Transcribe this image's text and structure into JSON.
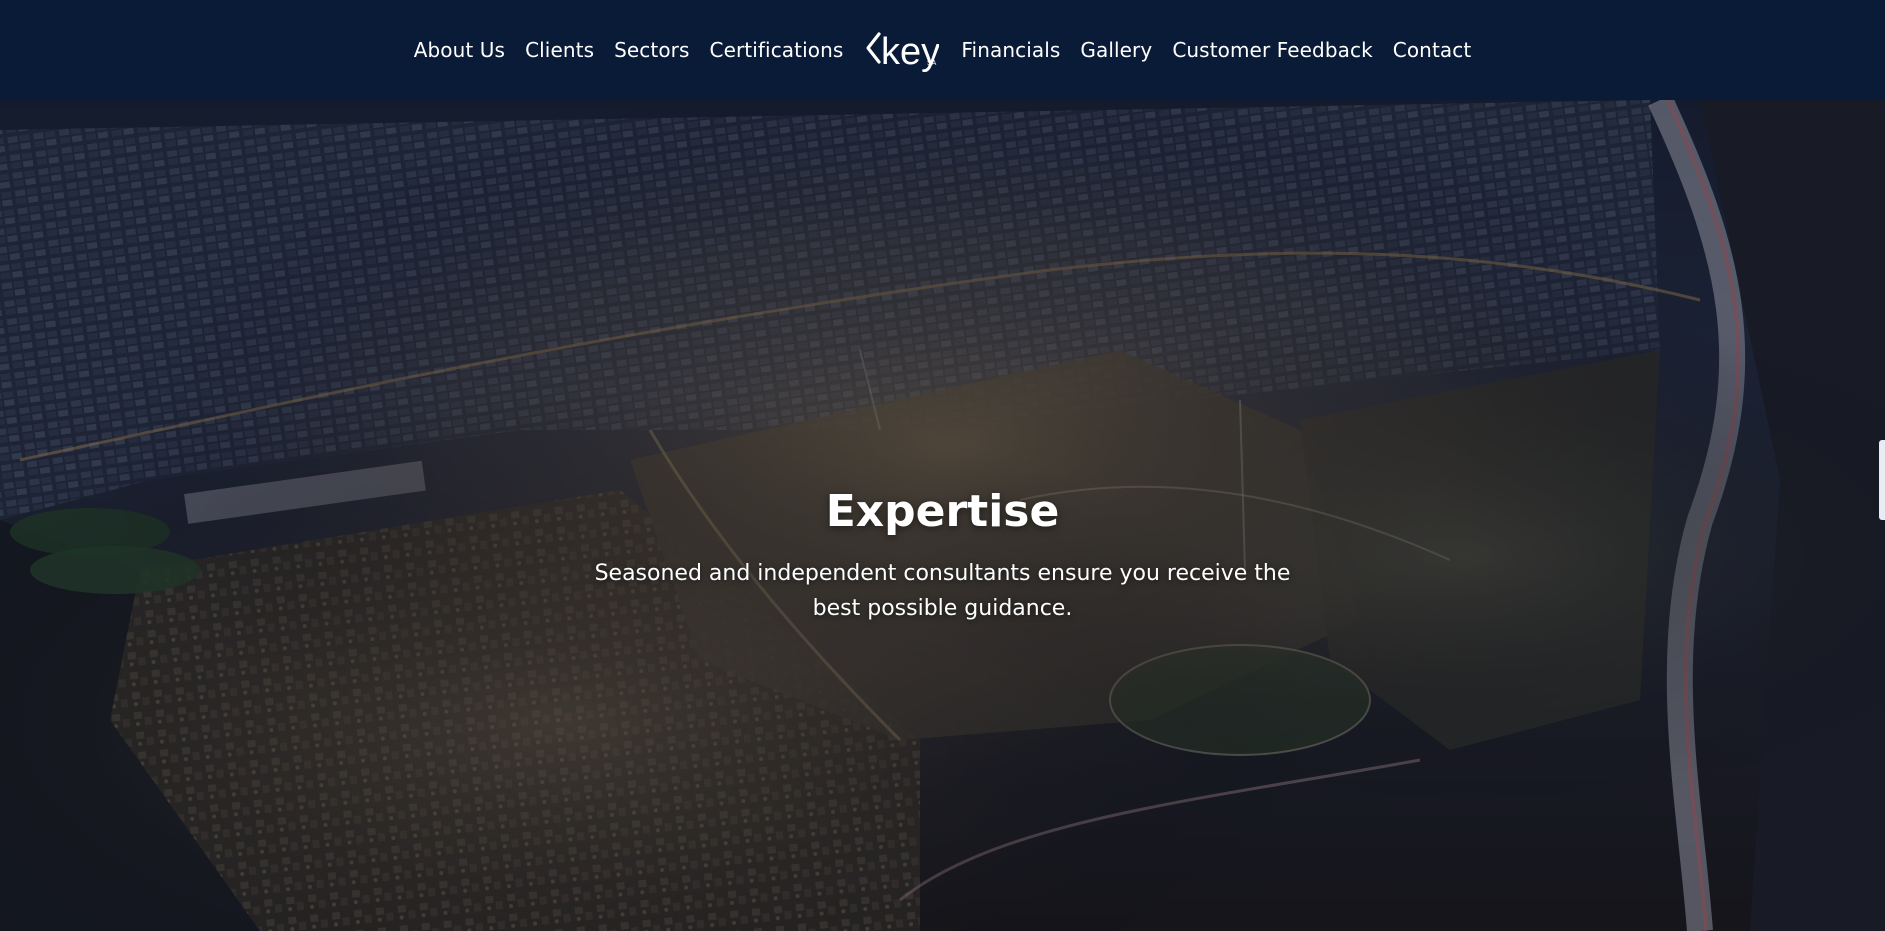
{
  "nav": {
    "left_items": [
      {
        "label": "About Us"
      },
      {
        "label": "Clients"
      },
      {
        "label": "Sectors"
      },
      {
        "label": "Certifications"
      }
    ],
    "right_items": [
      {
        "label": "Financials"
      },
      {
        "label": "Gallery"
      },
      {
        "label": "Customer Feedback"
      },
      {
        "label": "Contact"
      }
    ],
    "logo": {
      "text": "key",
      "suffix": "SA"
    }
  },
  "hero": {
    "title": "Expertise",
    "subtitle": "Seasoned and independent consultants ensure you receive the best possible guidance."
  },
  "colors": {
    "navbar_bg": "#0a1b38",
    "text": "#ffffff"
  }
}
